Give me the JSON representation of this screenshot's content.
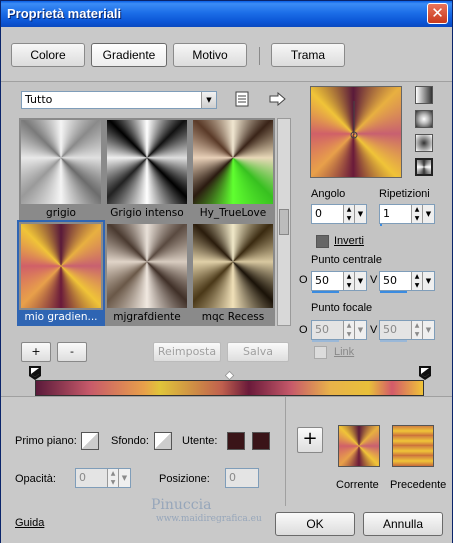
{
  "window": {
    "title": "Proprietà materiali",
    "close_glyph": "✕"
  },
  "tabs": [
    {
      "label": "Colore"
    },
    {
      "label": "Gradiente"
    },
    {
      "label": "Motivo"
    },
    {
      "label": "Trama"
    }
  ],
  "category_select": {
    "value": "Tutto"
  },
  "gradients": [
    {
      "name": "grigio"
    },
    {
      "name": "Grigio intenso"
    },
    {
      "name": "Hy_TrueLove"
    },
    {
      "name": "mio gradien..."
    },
    {
      "name": "mjgrafdiente"
    },
    {
      "name": "mqc Recess"
    }
  ],
  "right_panel": {
    "angle_label": "Angolo",
    "angle_value": "0",
    "repeats_label": "Ripetizioni",
    "repeats_value": "1",
    "invert_label": "Inverti",
    "center_label": "Punto centrale",
    "center_o_label": "O",
    "center_o_value": "50",
    "center_v_label": "V",
    "center_v_value": "50",
    "focal_label": "Punto focale",
    "focal_o_label": "O",
    "focal_o_value": "50",
    "focal_v_label": "V",
    "focal_v_value": "50",
    "link_label": "Link"
  },
  "edit_buttons": {
    "add": "+",
    "remove": "-",
    "reset": "Reimposta",
    "save": "Salva"
  },
  "bottom": {
    "foreground_label": "Primo piano:",
    "background_label": "Sfondo:",
    "user_label": "Utente:",
    "opacity_label": "Opacità:",
    "opacity_value": "0",
    "position_label": "Posizione:",
    "position_value": "0",
    "add_glyph": "+",
    "current_label": "Corrente",
    "previous_label": "Precedente"
  },
  "footer": {
    "help": "Guida",
    "ok": "OK",
    "cancel": "Annulla"
  },
  "watermark": {
    "line1": "Pinuccia",
    "line2": "www.maidiregrafica.eu"
  },
  "colors": {
    "title_blue": "#0b55d6",
    "selection_blue": "#2f65b3",
    "user_color": "#3a1418"
  }
}
